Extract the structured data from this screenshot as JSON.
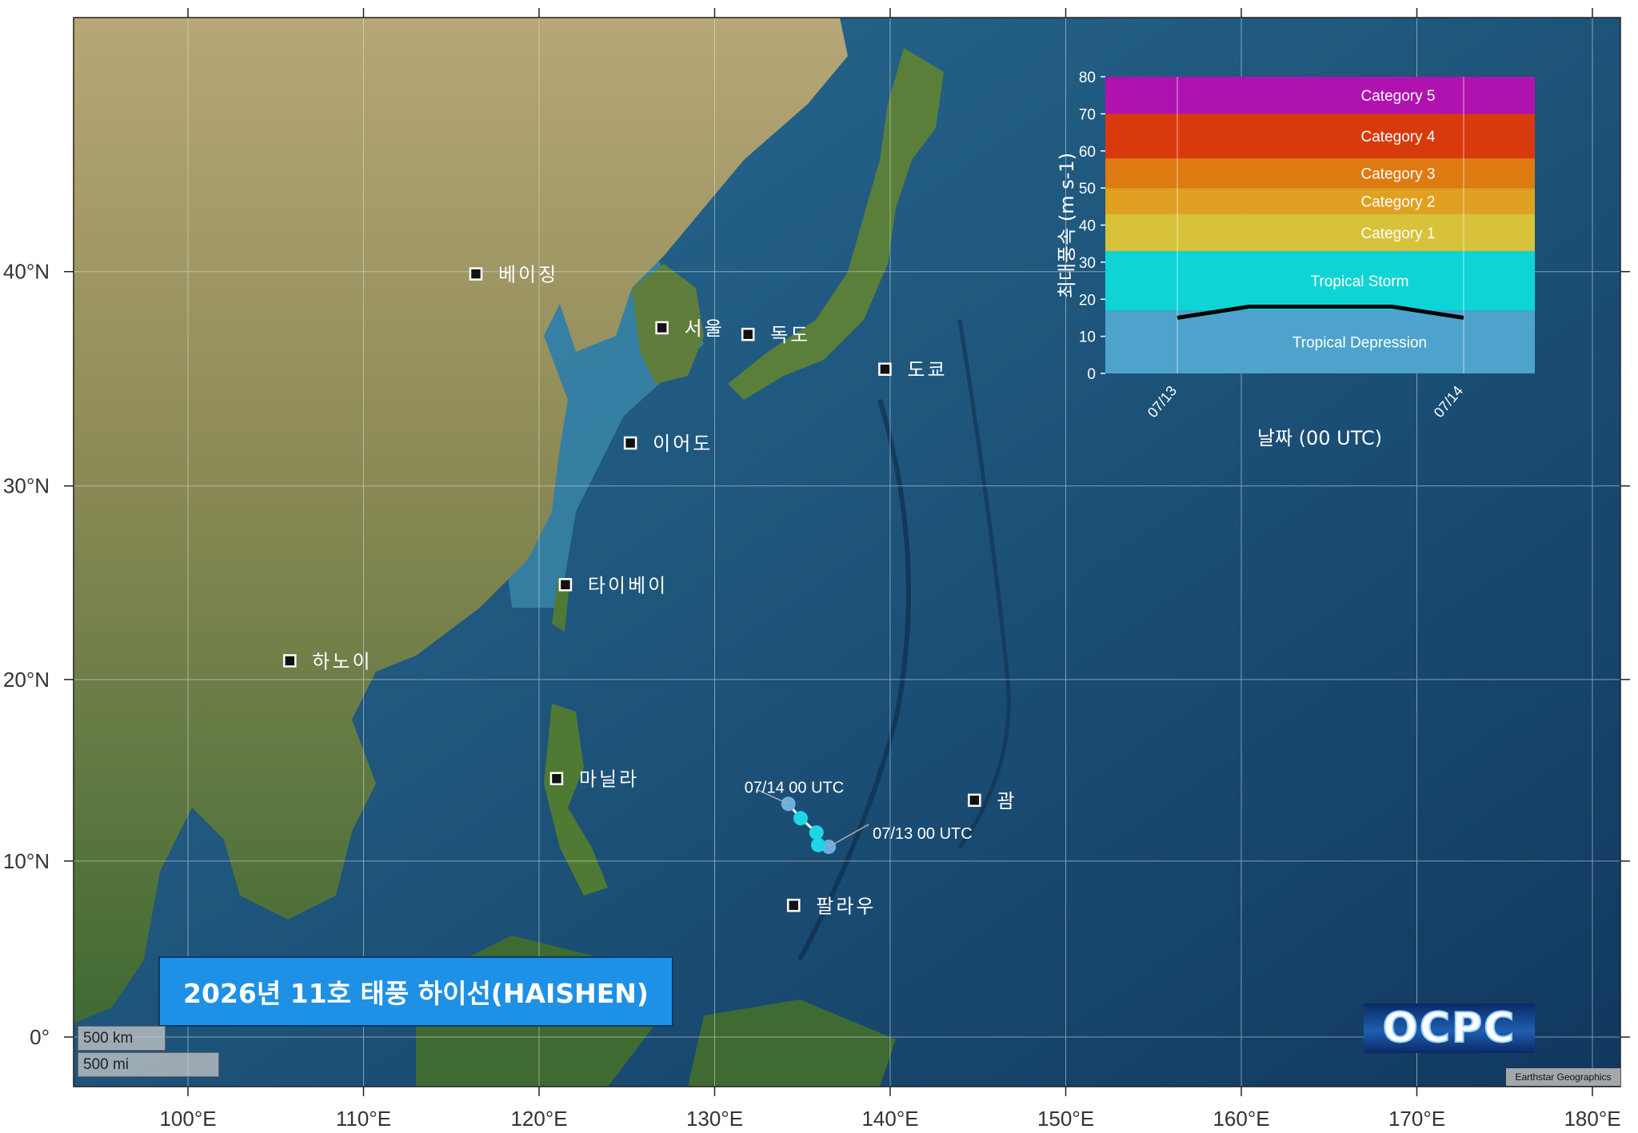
{
  "title": "2026년 11호 태풍 하이선(HAISHEN)",
  "map": {
    "lon_ticks": [
      "100°E",
      "110°E",
      "120°E",
      "130°E",
      "140°E",
      "150°E",
      "160°E",
      "170°E",
      "180°E"
    ],
    "lat_ticks": [
      "40°N",
      "30°N",
      "20°N",
      "10°N",
      "0°"
    ],
    "cities": [
      {
        "name": "베이징",
        "lon": 116.4,
        "lat": 39.9
      },
      {
        "name": "서울",
        "lon": 127.0,
        "lat": 37.5
      },
      {
        "name": "독도",
        "lon": 131.9,
        "lat": 37.2
      },
      {
        "name": "도쿄",
        "lon": 139.7,
        "lat": 35.6
      },
      {
        "name": "이어도",
        "lon": 125.2,
        "lat": 32.1
      },
      {
        "name": "타이베이",
        "lon": 121.5,
        "lat": 25.0
      },
      {
        "name": "하노이",
        "lon": 105.8,
        "lat": 21.0
      },
      {
        "name": "마닐라",
        "lon": 121.0,
        "lat": 14.6
      },
      {
        "name": "괌",
        "lon": 144.8,
        "lat": 13.4
      },
      {
        "name": "팔라우",
        "lon": 134.5,
        "lat": 7.5
      }
    ],
    "track": [
      {
        "lon": 136.5,
        "lat": 10.8,
        "color": "#6ab0e0"
      },
      {
        "lon": 135.9,
        "lat": 10.9,
        "color": "#1fd6e6"
      },
      {
        "lon": 135.8,
        "lat": 11.6,
        "color": "#1fd6e6"
      },
      {
        "lon": 134.9,
        "lat": 12.4,
        "color": "#1fd6e6"
      },
      {
        "lon": 134.2,
        "lat": 13.2,
        "color": "#6ab0e0"
      }
    ],
    "track_labels": {
      "start": "07/13 00 UTC",
      "end": "07/14 00 UTC"
    },
    "scale": {
      "km": "500 km",
      "mi": "500 mi"
    },
    "attribution": "Earthstar Geographics",
    "logo": "OCPC"
  },
  "chart_data": {
    "type": "line",
    "title": "",
    "xlabel": "날짜 (00 UTC)",
    "ylabel": "최대풍속 (m s-1)",
    "ylim": [
      0,
      80
    ],
    "yticks": [
      0,
      10,
      20,
      30,
      40,
      50,
      60,
      70,
      80
    ],
    "xticks": [
      "07/13",
      "07/14"
    ],
    "bands": [
      {
        "name": "Tropical Depression",
        "from": 0,
        "to": 17,
        "color": "#4da3cc"
      },
      {
        "name": "Tropical Storm",
        "from": 17,
        "to": 33,
        "color": "#0fd4d6"
      },
      {
        "name": "Category 1",
        "from": 33,
        "to": 43,
        "color": "#d8c23a"
      },
      {
        "name": "Category 2",
        "from": 43,
        "to": 50,
        "color": "#e0a020"
      },
      {
        "name": "Category 3",
        "from": 50,
        "to": 58,
        "color": "#de7a12"
      },
      {
        "name": "Category 4",
        "from": 58,
        "to": 70,
        "color": "#d83a0e"
      },
      {
        "name": "Category 5",
        "from": 70,
        "to": 80,
        "color": "#b012b0"
      }
    ],
    "series": [
      {
        "x": [
          0,
          0.25,
          0.5,
          0.75,
          1
        ],
        "values": [
          15,
          18,
          18,
          18,
          15
        ]
      }
    ]
  }
}
